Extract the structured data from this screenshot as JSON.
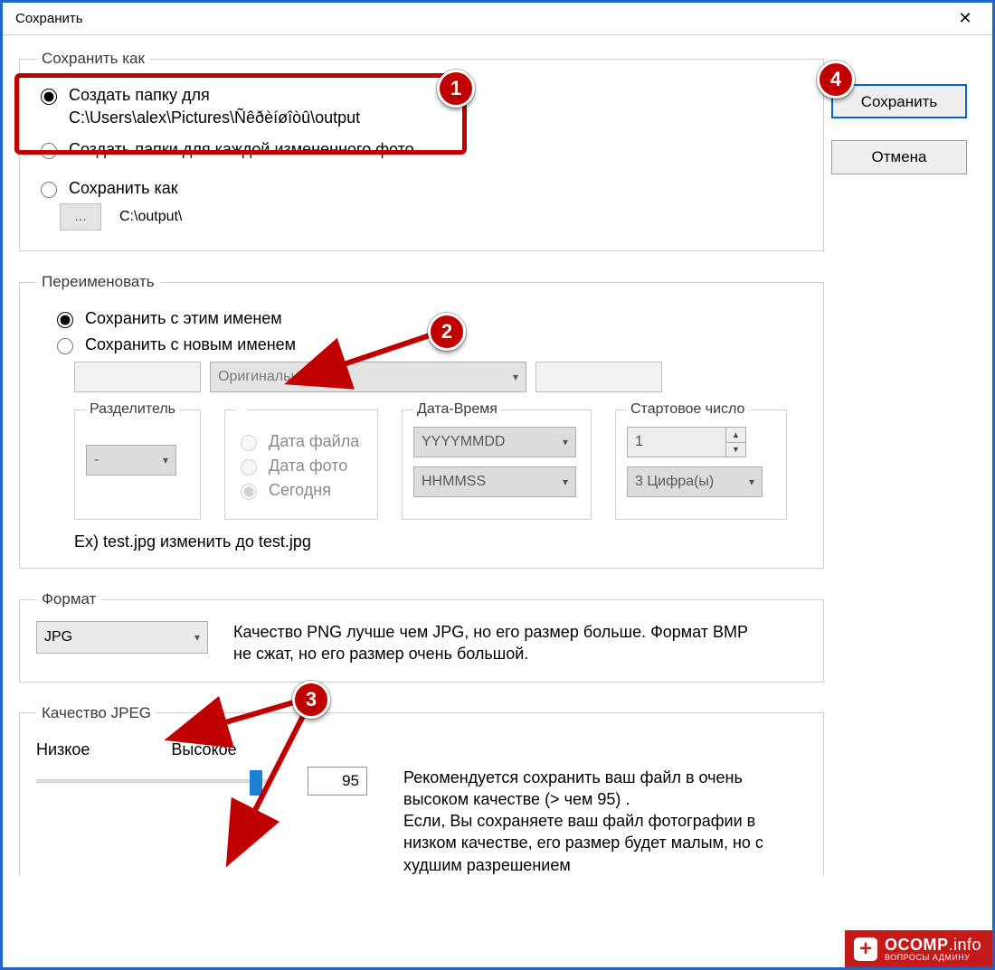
{
  "window": {
    "title": "Сохранить"
  },
  "buttons": {
    "save": "Сохранить",
    "cancel": "Отмена"
  },
  "saveAs": {
    "legend": "Сохранить как",
    "opt1": {
      "label": "Создать папку для",
      "path": "C:\\Users\\alex\\Pictures\\Ñêðèíøîòû\\output",
      "checked": true
    },
    "opt2": {
      "label": "Создать папки для каждой измененного фото",
      "checked": false
    },
    "opt3": {
      "label": "Сохранить как",
      "checked": false,
      "browse": "...",
      "path": "C:\\output\\"
    }
  },
  "rename": {
    "legend": "Переименовать",
    "keep": {
      "label": "Сохранить с этим именем",
      "checked": true
    },
    "new": {
      "label": "Сохранить с новым именем",
      "checked": false
    },
    "namePartSelect": "Оригинальное имя",
    "separator": {
      "legend": "Разделитель",
      "value": "-"
    },
    "datetime": {
      "legend": "Дата-Время",
      "fileDate": "Дата файла",
      "photoDate": "Дата фото",
      "today": "Сегодня",
      "fmtDate": "YYYYMMDD",
      "fmtTime": "HHMMSS"
    },
    "startNum": {
      "legend": "Стартовое число",
      "value": "1",
      "digits": "3 Цифра(ы)"
    },
    "example": "Ex) test.jpg изменить до test.jpg"
  },
  "format": {
    "legend": "Формат",
    "value": "JPG",
    "note": "Качество PNG лучше чем JPG, но его размер  больше. Формат BMP не сжат, но его размер  очень большой."
  },
  "quality": {
    "legend": "Качество JPEG",
    "low": "Низкое",
    "high": "Высокое",
    "value": "95",
    "note": "Рекомендуется сохранить ваш файл в  очень высоком качестве (> чем 95) .\nЕсли, Вы сохраняете ваш файл фотографии в низком качестве, его размер будет малым, но с худшим  разрешением"
  },
  "markers": {
    "m1": "1",
    "m2": "2",
    "m3": "3",
    "m4": "4"
  },
  "watermark": {
    "brand": "OCOMP",
    "suffix": ".info",
    "tagline": "ВОПРОСЫ АДМИНУ"
  }
}
